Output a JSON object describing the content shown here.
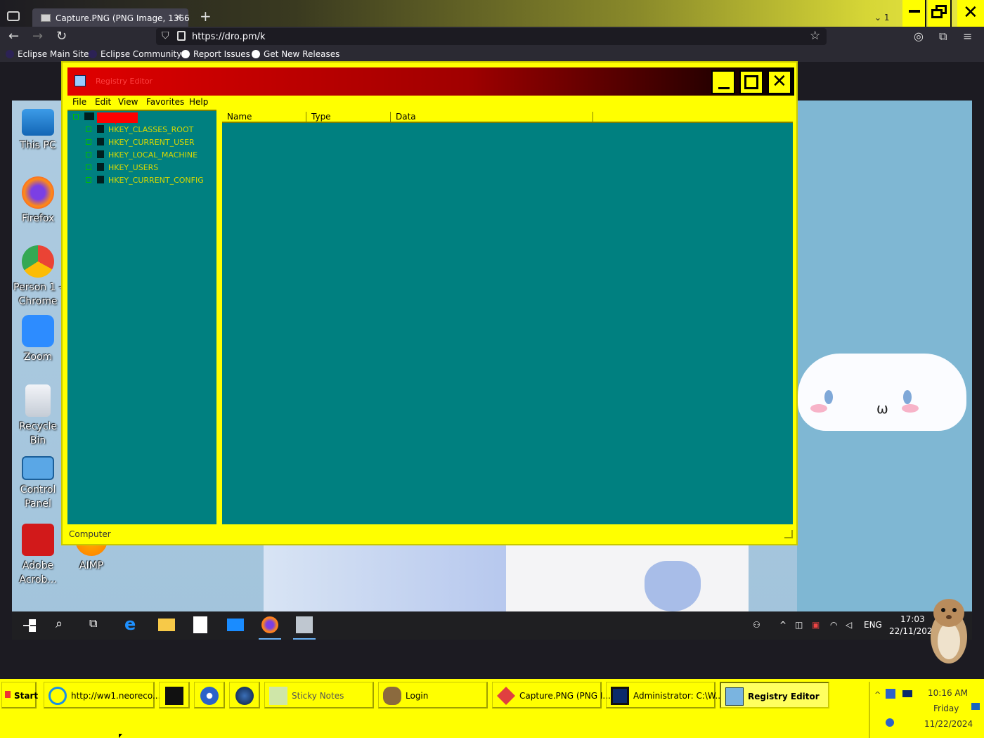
{
  "browser": {
    "tab_title": "Capture.PNG (PNG Image, 1366",
    "tab_close": "×",
    "new_tab": "+",
    "tab_count": "1",
    "url": "https://dro.pm/k",
    "bookmarks": [
      {
        "label": "Eclipse Main Site"
      },
      {
        "label": "Eclipse Community"
      },
      {
        "label": "Report Issues"
      },
      {
        "label": "Get New Releases"
      }
    ]
  },
  "desktop": {
    "icons": [
      {
        "label": "This PC"
      },
      {
        "label": "Firefox"
      },
      {
        "label": "Person 1 - Chrome"
      },
      {
        "label": "Zoom"
      },
      {
        "label": "Recycle Bin"
      },
      {
        "label": "Control Panel"
      },
      {
        "label": "Adobe Acrob..."
      },
      {
        "label": "AIMP"
      }
    ],
    "taskbar": {
      "lang": "ENG",
      "time": "17:03",
      "date": "22/11/2024"
    }
  },
  "regedit": {
    "title": "Registry Editor",
    "menu": [
      "File",
      "Edit",
      "View",
      "Favorites",
      "Help"
    ],
    "tree_root": "Computer",
    "tree_items": [
      "HKEY_CLASSES_ROOT",
      "HKEY_CURRENT_USER",
      "HKEY_LOCAL_MACHINE",
      "HKEY_USERS",
      "HKEY_CURRENT_CONFIG"
    ],
    "columns": [
      "Name",
      "Type",
      "Data"
    ],
    "status": "Computer"
  },
  "local_taskbar": {
    "start": "Start",
    "buttons": [
      {
        "label": "http://ww1.neoreco..."
      },
      {
        "label": ""
      },
      {
        "label": ""
      },
      {
        "label": ""
      },
      {
        "label": "Sticky Notes"
      },
      {
        "label": "Login"
      },
      {
        "label": "Capture.PNG (PNG I..."
      },
      {
        "label": "Administrator: C:\\W..."
      },
      {
        "label": "Registry Editor"
      }
    ],
    "clock": {
      "time": "10:16 AM",
      "day": "Friday",
      "date": "11/22/2024"
    }
  },
  "colors": {
    "accent_yellow": "#ffff00",
    "teal": "#008080",
    "title_red": "#e00000"
  }
}
